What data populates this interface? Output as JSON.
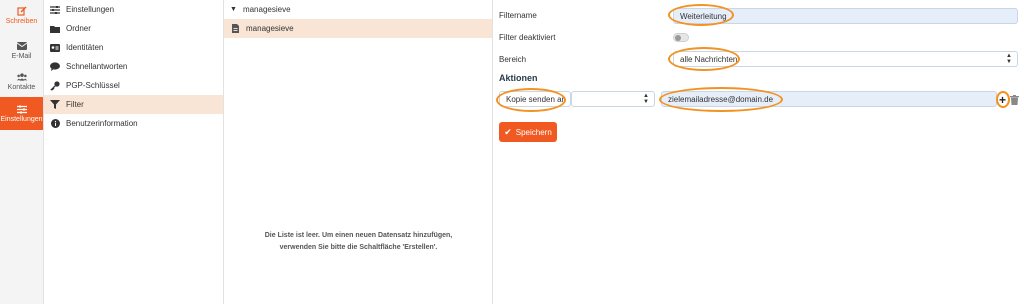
{
  "rail": [
    {
      "label": "Schreiben",
      "icon": "compose-icon"
    },
    {
      "label": "E-Mail",
      "icon": "mail-icon"
    },
    {
      "label": "Kontakte",
      "icon": "contacts-icon"
    },
    {
      "label": "Einstellungen",
      "icon": "settings-icon"
    }
  ],
  "settings": [
    {
      "label": "Einstellungen",
      "icon": "sliders-icon"
    },
    {
      "label": "Ordner",
      "icon": "folder-icon"
    },
    {
      "label": "Identitäten",
      "icon": "id-card-icon"
    },
    {
      "label": "Schnellantworten",
      "icon": "comment-icon"
    },
    {
      "label": "PGP-Schlüssel",
      "icon": "key-icon"
    },
    {
      "label": "Filter",
      "icon": "filter-icon"
    },
    {
      "label": "Benutzerinformation",
      "icon": "info-icon"
    }
  ],
  "filtersets": {
    "header": "managesieve",
    "item": "managesieve",
    "empty_line1": "Die Liste ist leer. Um einen neuen Datensatz hinzufügen,",
    "empty_line2": "verwenden Sie bitte die Schaltfläche 'Erstellen'."
  },
  "form": {
    "name_label": "Filtername",
    "name_value": "Weiterleitung",
    "disabled_label": "Filter deaktiviert",
    "scope_label": "Bereich",
    "scope_value": "alle Nachrichten",
    "actions_heading": "Aktionen",
    "action_value": "Kopie senden an",
    "action_param_value": "",
    "target_value": "zielemailadresse@domain.de",
    "save_label": "Speichern"
  },
  "colors": {
    "accent": "#f05a22",
    "highlight_ring": "#f39221",
    "selected_row": "#f9e5d5"
  }
}
